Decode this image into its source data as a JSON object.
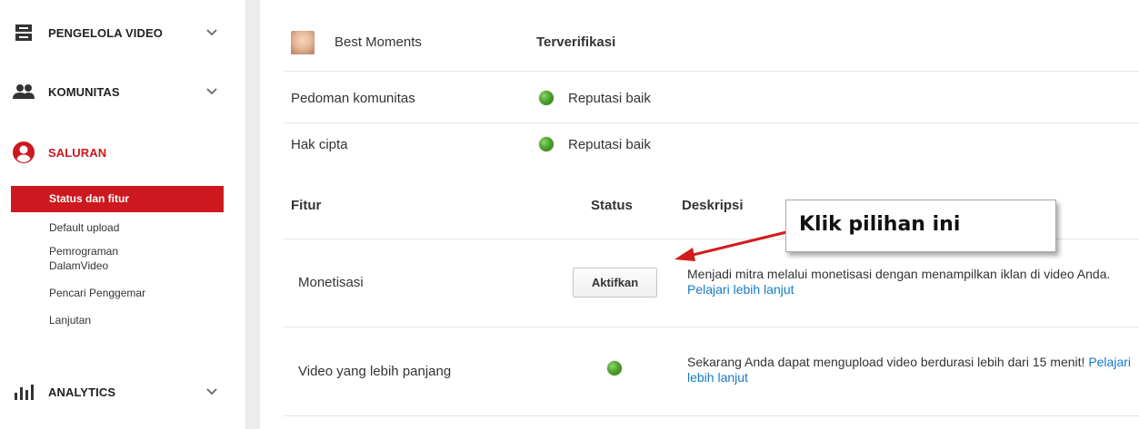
{
  "sidebar": {
    "sections": [
      {
        "label": "PENGELOLA VIDEO",
        "icon": "video-manager-icon"
      },
      {
        "label": "KOMUNITAS",
        "icon": "community-icon"
      },
      {
        "label": "SALURAN",
        "icon": "channel-icon"
      },
      {
        "label": "ANALYTICS",
        "icon": "analytics-icon"
      }
    ],
    "channel_items": [
      {
        "label": "Status dan fitur"
      },
      {
        "label": "Default upload"
      },
      {
        "label": "Pemrograman DalamVideo"
      },
      {
        "label": "Pencari Penggemar"
      },
      {
        "label": "Lanjutan"
      }
    ]
  },
  "status": {
    "channel_name": "Best Moments",
    "verified_label": "Terverifikasi",
    "community_label": "Pedoman komunitas",
    "community_status": "Reputasi baik",
    "copyright_label": "Hak cipta",
    "copyright_status": "Reputasi baik"
  },
  "features": {
    "headers": {
      "feature": "Fitur",
      "status": "Status",
      "description": "Deskripsi"
    },
    "rows": [
      {
        "name": "Monetisasi",
        "button": "Aktifkan",
        "description": "Menjadi mitra melalui monetisasi dengan menampilkan iklan di video Anda.",
        "link": "Pelajari lebih lanjut"
      },
      {
        "name": "Video yang lebih panjang",
        "description": "Sekarang Anda dapat mengupload video berdurasi lebih dari 15 menit!",
        "link": "Pelajari lebih lanjut"
      }
    ]
  },
  "annotation": {
    "text": "Klik pilihan ini"
  },
  "colors": {
    "accent": "#cc181e",
    "link": "#167ac6",
    "status_ok": "#4ea12d"
  }
}
